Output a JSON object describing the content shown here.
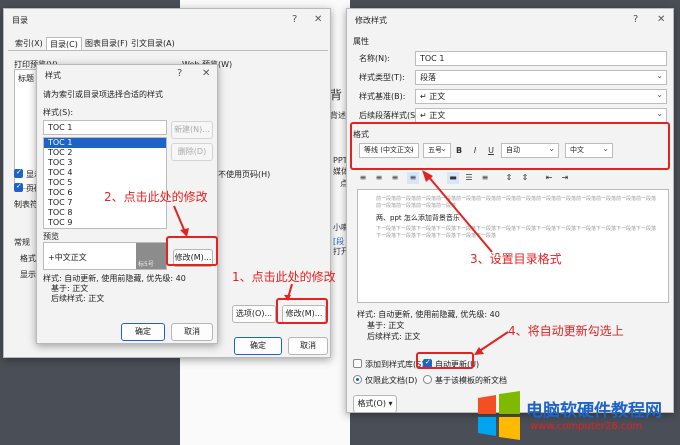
{
  "toc_dialog": {
    "title": "目录",
    "tabs": [
      "索引(X)",
      "目录(C)",
      "图表目录(F)",
      "引文目录(A)"
    ],
    "print_preview_label": "打印预览(V)",
    "web_preview_label": "Web 预览(W)",
    "preview_text": "标题",
    "show_page_numbers": "显示",
    "right_align": "页码",
    "tab_leader": "制表符",
    "general": "常规",
    "formats": "格式",
    "show_levels": "显示",
    "no_page_hyperlinks": "不使用页码(H)",
    "options_button": "选项(O)...",
    "modify_button": "修改(M)...",
    "ok_button": "确定",
    "cancel_button": "取消"
  },
  "style_dialog": {
    "title": "样式",
    "instruction": "请为索引或目录项选择合适的样式",
    "styles_label": "样式(S):",
    "style_value": "TOC 1",
    "styles": [
      "TOC 1",
      "TOC 2",
      "TOC 3",
      "TOC 4",
      "TOC 5",
      "TOC 6",
      "TOC 7",
      "TOC 8",
      "TOC 9"
    ],
    "new_button": "新建(N)...",
    "delete_button": "删除(D)",
    "preview_label": "预览",
    "preview_text": "+中文正文",
    "preview_size": "标5号",
    "modify_button": "修改(M)...",
    "description_lines": [
      "样式: 自动更新, 使用前隐藏, 优先级: 40",
      "基于: 正文",
      "后续样式: 正文"
    ],
    "ok_button": "确定",
    "cancel_button": "取消"
  },
  "modify_dialog": {
    "title": "修改样式",
    "properties_label": "属性",
    "name_label": "名称(N):",
    "name_value": "TOC 1",
    "type_label": "样式类型(T):",
    "type_value": "段落",
    "based_on_label": "样式基准(B):",
    "based_on_value": "↵ 正文",
    "following_label": "后续段落样式(S):",
    "following_value": "↵ 正文",
    "format_label": "格式",
    "font_value": "等线 (中文正文)",
    "size_value": "五号",
    "bold": "B",
    "italic": "I",
    "underline": "U",
    "color_value": "自动",
    "lang_value": "中文",
    "preview_sample_prev": "前一段落前一段落前一段落前一段落前一段落前一段落前一段落前一段落前一段落前一段落前一段落前一段落前一段落前一段落前一段落前一段落前一段落前一段落",
    "preview_sample_text": "两、ppt 怎么添加背景音乐",
    "preview_sample_next": "下一段落下一段落下一段落下一段落下一段落下一段落下一段落下一段落下一段落下一段落下一段落下一段落下一段落下一段落下一段落下一段落下一段落下一段落下一段落下一段落",
    "description_lines": [
      "样式: 自动更新, 使用前隐藏, 优先级: 40",
      "基于: 正文",
      "后续样式: 正文"
    ],
    "add_to_gallery": "添加到样式库(S)",
    "auto_update": "自动更新(U)",
    "only_this_doc": "仅限此文档(D)",
    "new_docs_template": "基于该模板的新文档",
    "format_button": "格式(O) ▾",
    "ok_button": "确定",
    "cancel_button": "取消"
  },
  "annotations": {
    "step1": "1、点击此处的修改",
    "step2": "2、点击此处的修改",
    "step3": "3、设置目录格式",
    "step4": "4、将自动更新勾选上"
  },
  "background_doc": {
    "text1": "背",
    "text2": "背述",
    "text3": "PPT",
    "text4": "媒体",
    "text5": "点",
    "text6": "小喇",
    "text7": "[段",
    "text8": "打开"
  },
  "watermark": {
    "title": "电脑软硬件教程网",
    "url": "www.computer26.com"
  }
}
